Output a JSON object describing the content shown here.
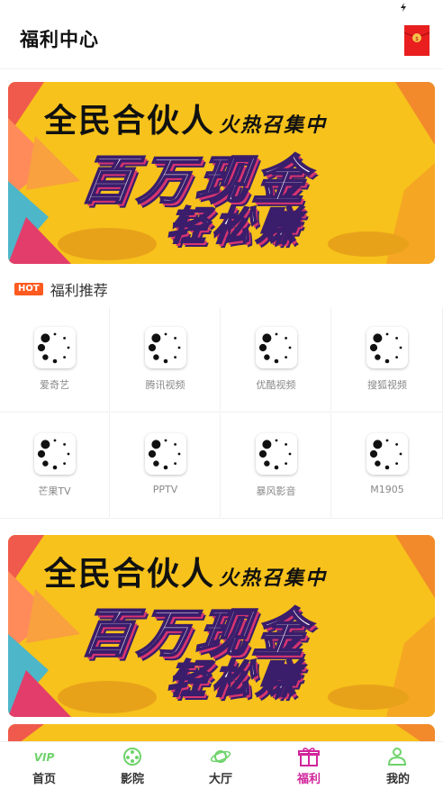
{
  "header": {
    "title": "福利中心"
  },
  "banner": {
    "line1": "全民合伙人",
    "line1_tag": "火热召集中",
    "line2": "百万现金",
    "line3": "轻松赚"
  },
  "section": {
    "badge": "HOT",
    "title": "福利推荐"
  },
  "apps": [
    {
      "label": "爱奇艺"
    },
    {
      "label": "腾讯视频"
    },
    {
      "label": "优酷视频"
    },
    {
      "label": "搜狐视频"
    },
    {
      "label": "芒果TV"
    },
    {
      "label": "PPTV"
    },
    {
      "label": "暴风影音"
    },
    {
      "label": "M1905"
    }
  ],
  "nav": {
    "items": [
      {
        "label": "首页",
        "icon": "vip-icon"
      },
      {
        "label": "影院",
        "icon": "film-reel-icon"
      },
      {
        "label": "大厅",
        "icon": "planet-icon"
      },
      {
        "label": "福利",
        "icon": "gift-icon"
      },
      {
        "label": "我的",
        "icon": "user-icon"
      }
    ],
    "active": "福利"
  },
  "colors": {
    "accent": "#d1269b",
    "hot": "#ff5a1f",
    "gift": "#e91e1e",
    "banner_bg": "#f7c21b"
  }
}
